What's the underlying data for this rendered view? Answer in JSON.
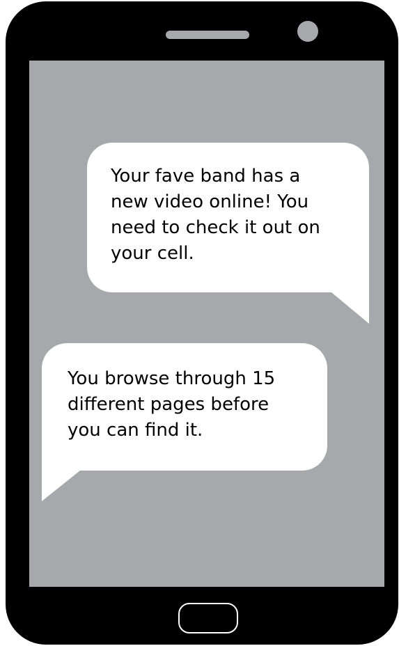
{
  "colors": {
    "phone_body": "#000000",
    "screen": "#a7a8ac",
    "bubble": "#ffffff",
    "text": "#000000"
  },
  "messages": [
    {
      "side": "right",
      "text": "Your fave band has a\nnew video online! You\nneed to check it out on\nyour cell."
    },
    {
      "side": "left",
      "text": "You browse through 15\ndifferent pages before\nyou can find it."
    }
  ],
  "icons": {
    "speaker": "speaker-grille-icon",
    "camera": "front-camera-icon",
    "home": "home-button-icon"
  }
}
